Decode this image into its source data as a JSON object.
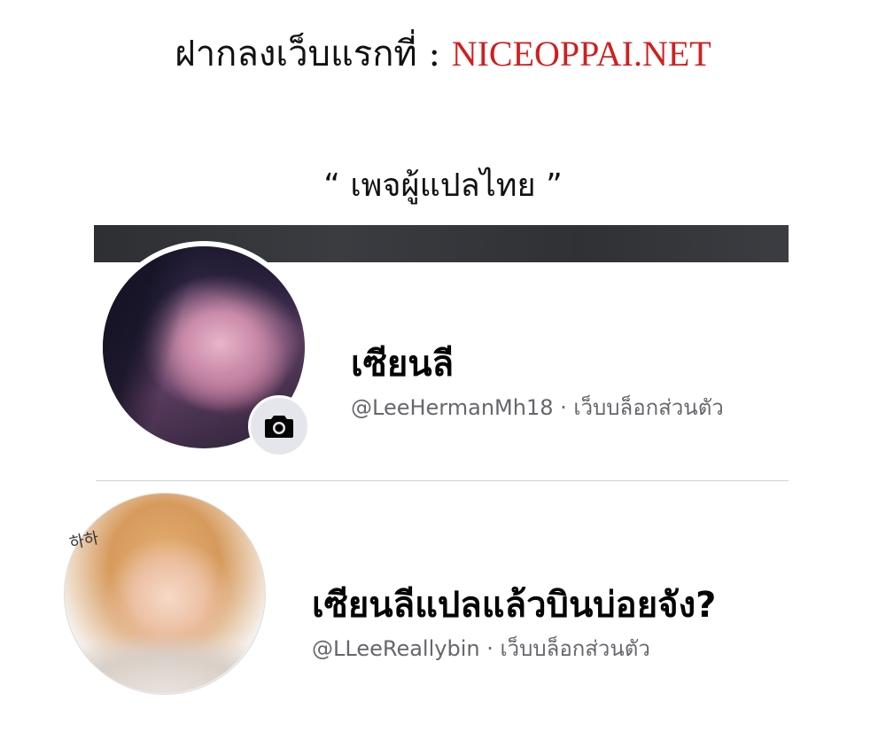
{
  "header": {
    "prefix": "ฝากลงเว็บแรกที่ : ",
    "site": "NICEOPPAI.NET",
    "site_color": "#d01f1f"
  },
  "subtitle": "“ เพจผู้แปลไทย ”",
  "profiles": [
    {
      "name": "เซียนลี",
      "handle": "@LeeHermanMh18 · เว็บบล็อกส่วนตัว",
      "badge_icon": "camera-icon"
    },
    {
      "name": "เซียนลีแปลแล้วบินบ่อยจัง?",
      "handle": "@LLeeReallybin · เว็บบล็อกส่วนตัว",
      "sticker_text": "하하"
    }
  ]
}
